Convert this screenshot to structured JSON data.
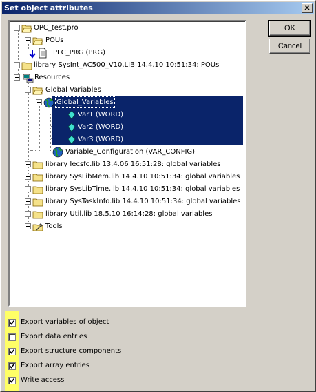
{
  "dialog": {
    "title": "Set object attributes",
    "ok_label": "OK",
    "cancel_label": "Cancel"
  },
  "tree": {
    "root": "OPC_test.pro",
    "pous": "POUs",
    "plc_prg": "PLC_PRG (PRG)",
    "lib_sysint": "library SysInt_AC500_V10.LIB 14.4.10 10:51:34: POUs",
    "resources": "Resources",
    "global_variables_folder": "Global Variables",
    "global_variables": "Global_Variables",
    "var1": "Var1 (WORD)",
    "var2": "Var2 (WORD)",
    "var3": "Var3 (WORD)",
    "var_config": "Variable_Configuration (VAR_CONFIG)",
    "lib_iecsfc": "library Iecsfc.lib 13.4.06 16:51:28: global variables",
    "lib_syslibmem": "library SysLibMem.lib 14.4.10 10:51:34: global variables",
    "lib_syslibtime": "library SysLibTime.lib 14.4.10 10:51:34: global variables",
    "lib_systaskinfo": "library SysTaskInfo.lib 14.4.10 10:51:34: global variables",
    "lib_util": "library Util.lib 18.5.10 16:14:28: global variables",
    "tools": "Tools"
  },
  "options": [
    {
      "label": "Export variables of object",
      "checked": true
    },
    {
      "label": "Export data entries",
      "checked": false
    },
    {
      "label": "Export structure components",
      "checked": true
    },
    {
      "label": "Export array entries",
      "checked": true
    },
    {
      "label": "Write access",
      "checked": true
    }
  ],
  "colors": {
    "selection": "#0a246a",
    "highlight": "#ffff66",
    "folder": "#f5e28a"
  }
}
